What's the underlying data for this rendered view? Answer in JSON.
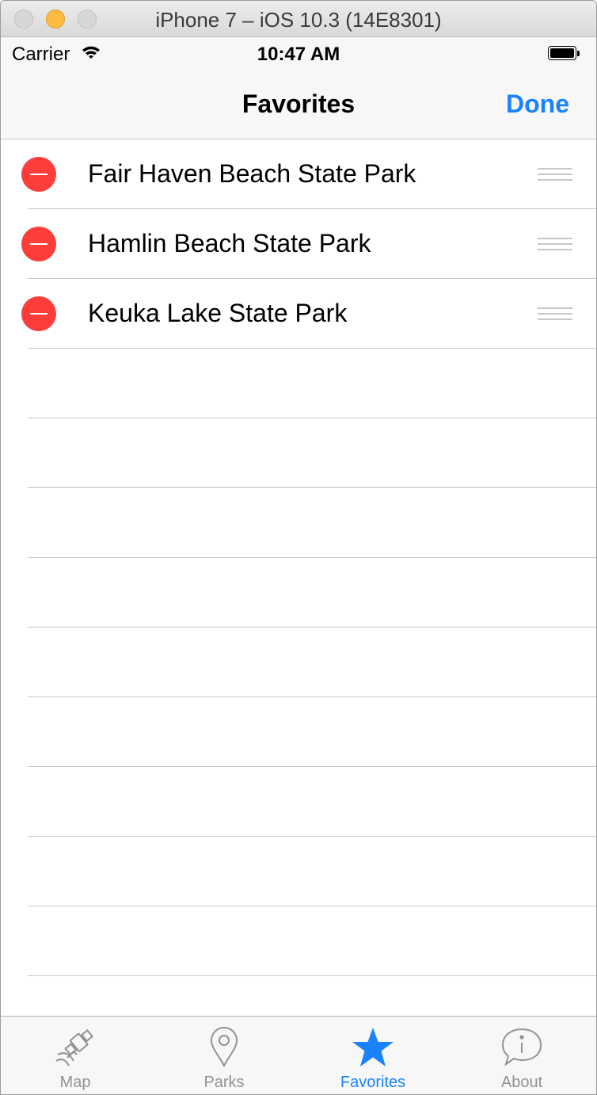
{
  "window": {
    "title": "iPhone 7 – iOS 10.3 (14E8301)"
  },
  "status_bar": {
    "carrier": "Carrier",
    "time": "10:47 AM"
  },
  "nav": {
    "title": "Favorites",
    "done_label": "Done"
  },
  "favorites": [
    {
      "name": "Fair Haven Beach State Park"
    },
    {
      "name": "Hamlin Beach State Park"
    },
    {
      "name": "Keuka Lake State Park"
    }
  ],
  "tabs": [
    {
      "label": "Map",
      "icon": "map-icon",
      "active": false
    },
    {
      "label": "Parks",
      "icon": "pin-icon",
      "active": false
    },
    {
      "label": "Favorites",
      "icon": "star-icon",
      "active": true
    },
    {
      "label": "About",
      "icon": "info-icon",
      "active": false
    }
  ],
  "colors": {
    "accent": "#1a82fb",
    "delete": "#fc3d39",
    "inactive_tab": "#929292",
    "separator": "#c8c7cc"
  }
}
